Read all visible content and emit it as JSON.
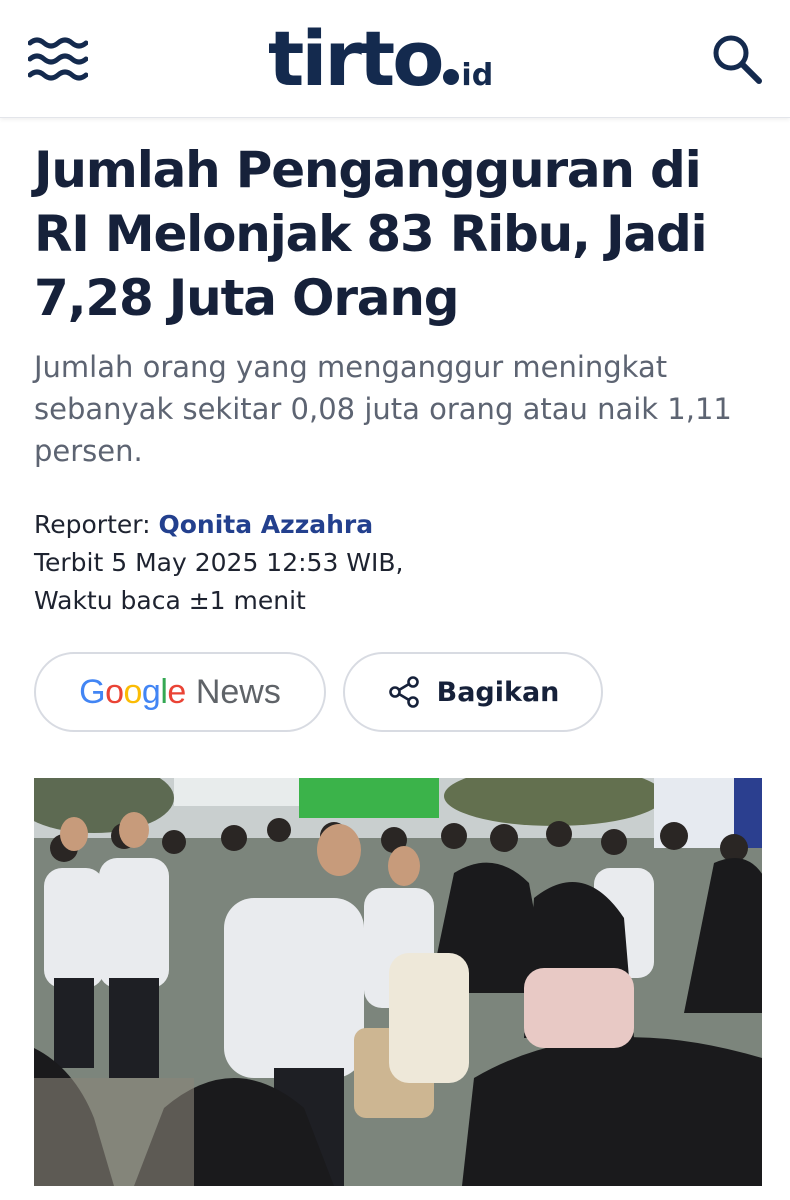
{
  "site": {
    "logo_main": "tirto",
    "logo_tld": "id",
    "brand_color": "#142a4e"
  },
  "header": {
    "menu_icon": "menu-wave-icon",
    "search_icon": "search-icon"
  },
  "article": {
    "title": "Jumlah Pengangguran di RI Melonjak 83 Ribu, Jadi 7,28 Juta Orang",
    "lede": "Jumlah orang yang menganggur meningkat sebanyak sekitar 0,08 juta orang atau naik 1,11 persen.",
    "reporter_label": "Reporter:",
    "reporter_name": "Qonita Azzahra",
    "published": "Terbit 5 May 2025 12:53 WIB,",
    "read_time": "Waktu baca ±1 menit",
    "reporter_color": "#23408e"
  },
  "actions": {
    "google_news": {
      "google_letters": [
        "G",
        "o",
        "o",
        "g",
        "l",
        "e"
      ],
      "news_label": "News"
    },
    "share_label": "Bagikan",
    "share_icon": "share-icon"
  },
  "photo": {
    "description_icon": "article-photo"
  }
}
